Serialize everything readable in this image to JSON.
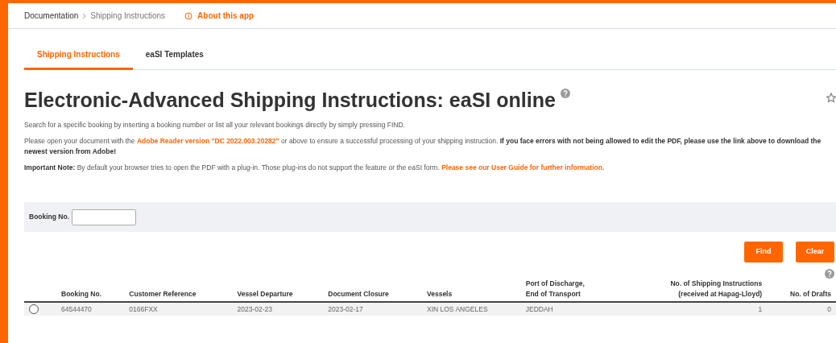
{
  "breadcrumb": [
    "Documentation",
    "Shipping Instructions"
  ],
  "about_link": "About this app",
  "tabs": [
    {
      "label": "Shipping Instructions",
      "selected": true
    },
    {
      "label": "eaSI Templates",
      "selected": false
    }
  ],
  "title": "Electronic-Advanced Shipping Instructions: eaSI online",
  "paragraphs": [
    "Search for a specific booking by inserting a booking number or list all your relevant bookings directly by simply pressing FIND.",
    "Please open your document with the **Adobe Reader version \"DC 2022.003.20282\"** or above to ensure a successful processing of your shipping instruction. **If you face errors with not being allowed to edit the PDF, please use the link above to download the newest version from Adobe!**",
    "**Important Note:** By default your browser tries to open the PDF with a plug-in. Those plug-ins do not support the feature or the eaSI form. **Please see our User Guide for further information.**"
  ],
  "search": {
    "label": "Booking No."
  },
  "buttons": [
    "Find",
    "Clear"
  ],
  "table": {
    "columns": [
      {
        "lines": [
          "Booking No."
        ],
        "kind": "text"
      },
      {
        "lines": [
          "Customer Reference"
        ],
        "kind": "text"
      },
      {
        "lines": [
          "Vessel Departure"
        ],
        "kind": "text"
      },
      {
        "lines": [
          "Document Closure"
        ],
        "kind": "text"
      },
      {
        "lines": [
          "Vessels"
        ],
        "kind": "text"
      },
      {
        "lines": [
          "Port of Discharge,",
          "End of Transport"
        ],
        "kind": "text"
      },
      {
        "lines": [
          "No. of Shipping Instructions",
          "(received at Hapag-Lloyd)"
        ],
        "kind": "count"
      },
      {
        "lines": [
          "No. of Drafts"
        ],
        "kind": "count"
      }
    ],
    "rows": [
      {
        "selected": false,
        "cells": [
          "64544470",
          "0166FXX",
          "2023-02-23",
          "2023-02-17",
          "XIN LOS ANGELES",
          "JEDDAH",
          "1",
          "0"
        ]
      }
    ]
  }
}
